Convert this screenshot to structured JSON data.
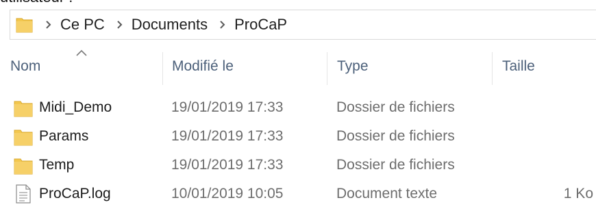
{
  "caption_fragment": "utilisateur :",
  "breadcrumb": [
    "Ce PC",
    "Documents",
    "ProCaP"
  ],
  "columns": {
    "name": "Nom",
    "modified": "Modifié le",
    "type": "Type",
    "size": "Taille"
  },
  "files": [
    {
      "name": "Midi_Demo",
      "modified": "19/01/2019 17:33",
      "type": "Dossier de fichiers",
      "size": "",
      "icon": "folder-icon"
    },
    {
      "name": "Params",
      "modified": "19/01/2019 17:33",
      "type": "Dossier de fichiers",
      "size": "",
      "icon": "folder-icon"
    },
    {
      "name": "Temp",
      "modified": "19/01/2019 17:33",
      "type": "Dossier de fichiers",
      "size": "",
      "icon": "folder-icon"
    },
    {
      "name": "ProCaP.log",
      "modified": "10/01/2019 10:05",
      "type": "Document texte",
      "size": "1 Ko",
      "icon": "text-document-icon"
    }
  ],
  "colors": {
    "folder": "#f3c74e",
    "header_text": "#4c607a",
    "border": "#d9d9d9"
  }
}
